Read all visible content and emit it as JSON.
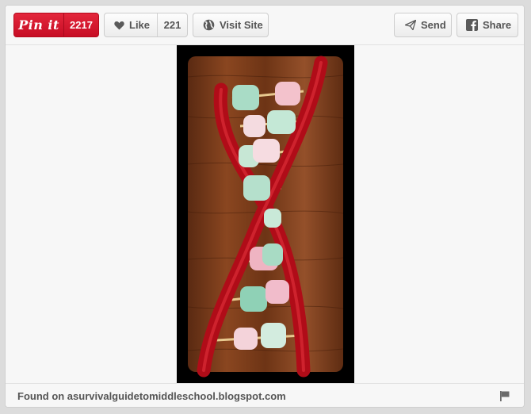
{
  "toolbar": {
    "pin_label": "Pin it",
    "pin_count": "2217",
    "like_label": "Like",
    "like_count": "221",
    "visit_label": "Visit Site",
    "send_label": "Send",
    "share_label": "Share"
  },
  "icons": {
    "like": "heart-icon",
    "visit": "globe-icon",
    "send": "paper-plane-icon",
    "share": "facebook-icon",
    "flag": "flag-icon"
  },
  "footer": {
    "found_on": "Found on asurvivalguidetomiddleschool.blogspot.com"
  },
  "colors": {
    "pin_red": "#cb2027",
    "licorice": "#c0101c"
  }
}
